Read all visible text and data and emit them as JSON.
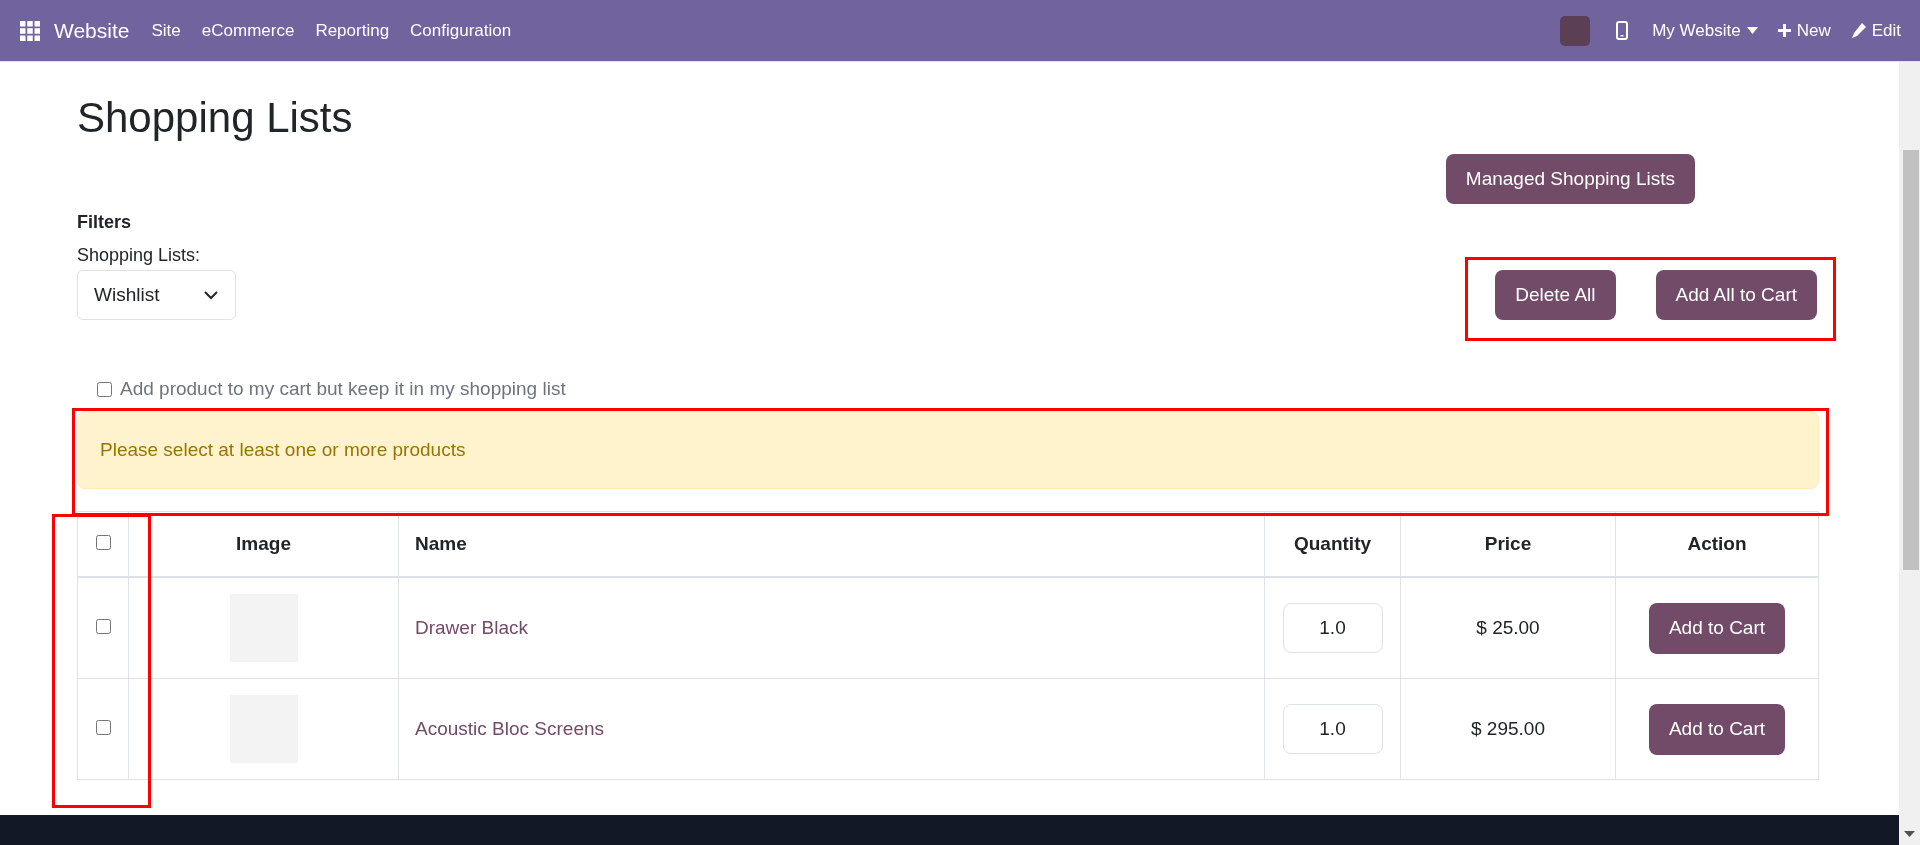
{
  "navbar": {
    "app": "Website",
    "menu": [
      "Site",
      "eCommerce",
      "Reporting",
      "Configuration"
    ],
    "website": "My Website",
    "new": "New",
    "edit": "Edit"
  },
  "page": {
    "title": "Shopping Lists",
    "managed_button": "Managed Shopping Lists",
    "filters_label": "Filters",
    "list_label": "Shopping Lists:",
    "list_value": "Wishlist",
    "actions": [
      "Delete All",
      "Add All to Cart"
    ],
    "keep_option": {
      "label": "Add product to my cart but keep it in my shopping list",
      "checked": false
    },
    "alert": "Please select at least one or more products"
  },
  "table": {
    "columns": [
      "Image",
      "Name",
      "Quantity",
      "Price",
      "Action"
    ],
    "all_checked": false,
    "rows": [
      {
        "checked": false,
        "name": "Drawer Black",
        "quantity": "1.0",
        "price": "$ 25.00",
        "action": "Add to Cart"
      },
      {
        "checked": false,
        "name": "Acoustic Bloc Screens",
        "quantity": "1.0",
        "price": "$ 295.00",
        "action": "Add to Cart"
      }
    ]
  }
}
